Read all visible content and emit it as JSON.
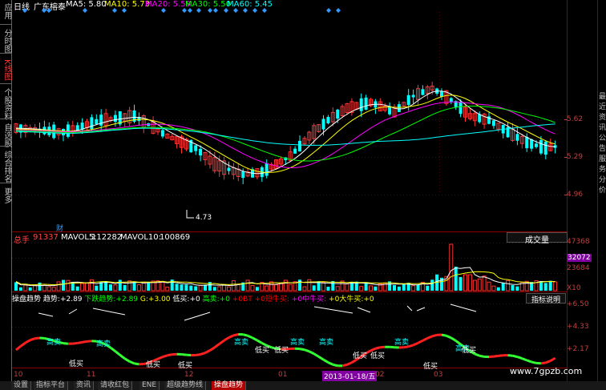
{
  "sidebar": {
    "items": [
      {
        "label": "应用"
      },
      {
        "label": "分时图"
      },
      {
        "label": "K线图"
      },
      {
        "label": "个股资料"
      },
      {
        "label": "自选股"
      },
      {
        "label": "综合排名"
      },
      {
        "label": "更多"
      }
    ]
  },
  "price_panel": {
    "period": "日线",
    "stock_name": "广东榕泰",
    "ma": [
      {
        "label": "MA5: 5.80",
        "color": "#ffffff"
      },
      {
        "label": "MA10: 5.73",
        "color": "#ffff00"
      },
      {
        "label": "MA20: 5.59",
        "color": "#ff00ff"
      },
      {
        "label": "MA30: 5.50",
        "color": "#00ff00"
      },
      {
        "label": "MA60: 5.45",
        "color": "#00ffff"
      }
    ],
    "y_ticks": [
      "5.62",
      "5.29",
      "4.96"
    ],
    "low_marker": "4.73",
    "fin_marker": "财"
  },
  "volume_panel": {
    "title": "总手",
    "total": "91337",
    "mavol5_label": "MAVOL5:",
    "mavol5": "112282",
    "mavol10_label": "MAVOL10:",
    "mavol10": "100869",
    "selector": "成交量",
    "y_ticks": [
      "47368",
      "32072",
      "23684",
      "X10"
    ]
  },
  "indicator_panel": {
    "name": "操盘趋势",
    "trend_label": "趋势:",
    "trend_value": "+2.89",
    "down_label": "下跌趋势:",
    "down_value": "+2.89",
    "g_label": "G:",
    "g_value": "+3.00",
    "low_buy_label": "低买:",
    "low_buy_value": "+0",
    "high_sell_label": "高卖:",
    "high_sell_value": "+0",
    "bt_label": "BT",
    "bt_value": "+0",
    "short_bull_label": "短牛买:",
    "short_bull_value": "+0",
    "mid_bull_label": "中牛买:",
    "mid_bull_value": "+0",
    "big_bull_label": "大牛买:",
    "big_bull_value": "+0",
    "help_button": "指标说明",
    "y_ticks": [
      "+6.50",
      "+4.33",
      "+2.17"
    ],
    "annotations": [
      {
        "text": "高卖",
        "color": "#00ffff"
      },
      {
        "text": "低买",
        "color": "#ffffff"
      },
      {
        "text": "高卖",
        "color": "#00ffff"
      },
      {
        "text": "低买",
        "color": "#ffffff"
      },
      {
        "text": "低买",
        "color": "#ffffff"
      },
      {
        "text": "高卖",
        "color": "#00ffff"
      },
      {
        "text": "低买",
        "color": "#ffffff"
      },
      {
        "text": "高卖",
        "color": "#00ffff"
      },
      {
        "text": "低买",
        "color": "#ffffff"
      },
      {
        "text": "高卖",
        "color": "#00ffff"
      },
      {
        "text": "低买",
        "color": "#ffffff"
      },
      {
        "text": "高卖",
        "color": "#00ffff"
      },
      {
        "text": "低买",
        "color": "#ffffff"
      },
      {
        "text": "低买",
        "color": "#ffffff"
      },
      {
        "text": "高卖",
        "color": "#00ffff"
      },
      {
        "text": "低买",
        "color": "#ffffff"
      }
    ]
  },
  "x_axis": {
    "labels": [
      "10",
      "11",
      "12",
      "01",
      "02",
      "03"
    ],
    "highlight_date": "2013-01-18/五"
  },
  "watermark": "www.7gpzb.com",
  "right_text": [
    "最",
    "近",
    "资",
    "讯",
    "公",
    "告",
    "服",
    "务",
    "分",
    "价"
  ],
  "bottom_tabs": [
    {
      "label": "设置"
    },
    {
      "label": "指标平台"
    },
    {
      "label": "资讯"
    },
    {
      "label": "请收红包"
    },
    {
      "label": "ENE"
    },
    {
      "label": "超级趋势线"
    },
    {
      "label": "操盘趋势",
      "active": true
    }
  ]
}
